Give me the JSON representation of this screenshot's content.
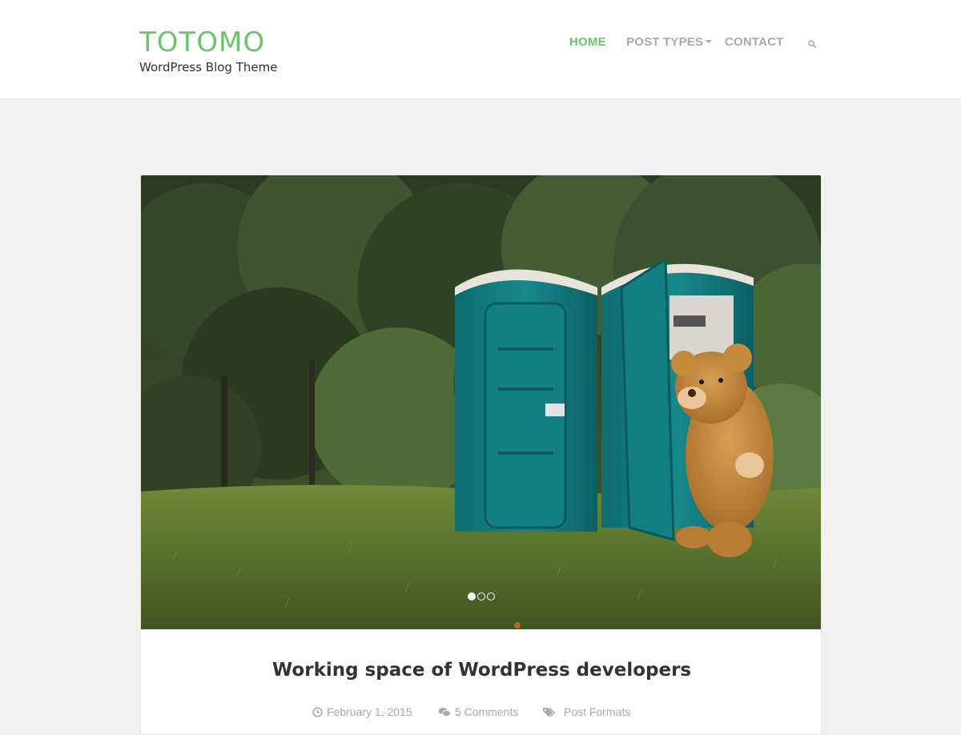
{
  "site": {
    "title": "TOTOMO",
    "description": "WordPress Blog Theme"
  },
  "nav": {
    "items": [
      {
        "label": "HOME",
        "active": true
      },
      {
        "label": "POST TYPES",
        "has_dropdown": true
      },
      {
        "label": "CONTACT"
      }
    ],
    "search_icon": "search-icon"
  },
  "slider": {
    "image": "Two teal portable toilets on a lawn with a giant teddy bear stepping out of one, trees in the background",
    "dot_count": 3,
    "active_dot": 1
  },
  "post": {
    "title": "Working space of WordPress developers",
    "date": "February 1, 2015",
    "comments": "5 Comments",
    "category": "Post Formats"
  },
  "colors": {
    "accent": "#6cc46a",
    "nav_inactive": "#a9a9a9",
    "background": "#f1f1f1"
  }
}
